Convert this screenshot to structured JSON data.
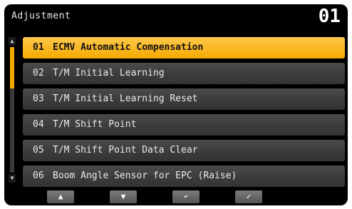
{
  "header": {
    "title": "Adjustment",
    "page_number": "01"
  },
  "menu": {
    "items": [
      {
        "num": "01",
        "label": "ECMV Automatic Compensation"
      },
      {
        "num": "02",
        "label": "T/M Initial Learning"
      },
      {
        "num": "03",
        "label": "T/M Initial Learning Reset"
      },
      {
        "num": "04",
        "label": "T/M Shift Point"
      },
      {
        "num": "05",
        "label": "T/M Shift Point Data Clear"
      },
      {
        "num": "06",
        "label": "Boom Angle Sensor for EPC (Raise)"
      }
    ],
    "selected_index": 0
  },
  "scrollbar": {
    "up_icon": "▲",
    "down_icon": "▼"
  },
  "footer": {
    "buttons": [
      {
        "name": "up-button",
        "icon": "triangle-up-icon",
        "glyph": "▲"
      },
      {
        "name": "down-button",
        "icon": "triangle-down-icon",
        "glyph": "▼"
      },
      {
        "name": "back-button",
        "icon": "return-arrow-icon",
        "glyph": "↶"
      },
      {
        "name": "confirm-button",
        "icon": "checkmark-icon",
        "glyph": "✓"
      }
    ]
  },
  "colors": {
    "accent": "#f5a900",
    "background": "#000000",
    "row": "#3b3b3b"
  }
}
